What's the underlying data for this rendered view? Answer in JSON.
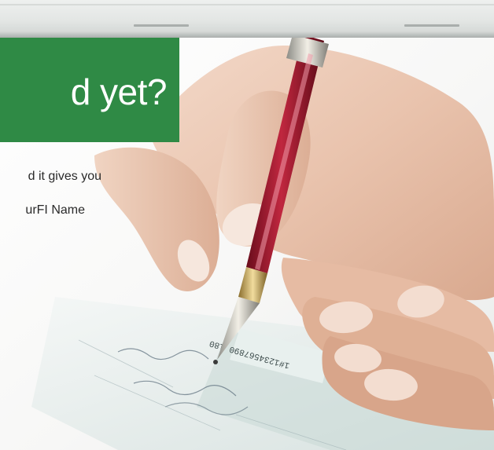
{
  "headline": {
    "text": "d yet?",
    "background_color": "#2f8a45",
    "text_color": "#ffffff"
  },
  "body": {
    "line_1": "d it gives you",
    "line_2": "urFI Name"
  },
  "photo": {
    "subject": "hand-writing-check-with-pen"
  }
}
